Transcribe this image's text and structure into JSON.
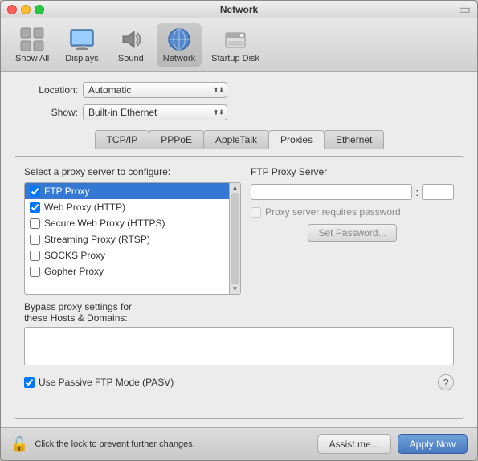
{
  "window": {
    "title": "Network"
  },
  "toolbar": {
    "items": [
      {
        "id": "show-all",
        "label": "Show All",
        "icon": "🔲"
      },
      {
        "id": "displays",
        "label": "Displays",
        "icon": "🖥"
      },
      {
        "id": "sound",
        "label": "Sound",
        "icon": "🔊"
      },
      {
        "id": "network",
        "label": "Network",
        "icon": "🌐"
      },
      {
        "id": "startup-disk",
        "label": "Startup Disk",
        "icon": "💿"
      }
    ]
  },
  "form": {
    "location_label": "Location:",
    "location_value": "Automatic",
    "show_label": "Show:",
    "show_value": "Built-in Ethernet"
  },
  "tabs": [
    {
      "id": "tcpip",
      "label": "TCP/IP"
    },
    {
      "id": "pppoe",
      "label": "PPPoE"
    },
    {
      "id": "appletalk",
      "label": "AppleTalk"
    },
    {
      "id": "proxies",
      "label": "Proxies",
      "active": true
    },
    {
      "id": "ethernet",
      "label": "Ethernet"
    }
  ],
  "panel": {
    "proxy_select_title": "Select a proxy server to configure:",
    "proxy_items": [
      {
        "id": "ftp",
        "label": "FTP Proxy",
        "checked": true,
        "selected": true
      },
      {
        "id": "web",
        "label": "Web Proxy (HTTP)",
        "checked": true,
        "selected": false
      },
      {
        "id": "secure",
        "label": "Secure Web Proxy (HTTPS)",
        "checked": false,
        "selected": false
      },
      {
        "id": "streaming",
        "label": "Streaming Proxy (RTSP)",
        "checked": false,
        "selected": false
      },
      {
        "id": "socks",
        "label": "SOCKS Proxy",
        "checked": false,
        "selected": false
      },
      {
        "id": "gopher",
        "label": "Gopher Proxy",
        "checked": false,
        "selected": false
      }
    ],
    "ftp_server_title": "FTP Proxy Server",
    "ftp_server_placeholder": "",
    "ftp_port_placeholder": "",
    "proxy_password_label": "Proxy server requires password",
    "set_password_label": "Set Password...",
    "bypass_line1": "Bypass proxy settings for",
    "bypass_line2": "these Hosts & Domains:",
    "bypass_value": "",
    "passive_label": "Use Passive FTP Mode (PASV)",
    "passive_checked": true
  },
  "bottom": {
    "lock_text": "Click the lock to prevent further changes.",
    "assist_label": "Assist me...",
    "apply_label": "Apply Now"
  }
}
